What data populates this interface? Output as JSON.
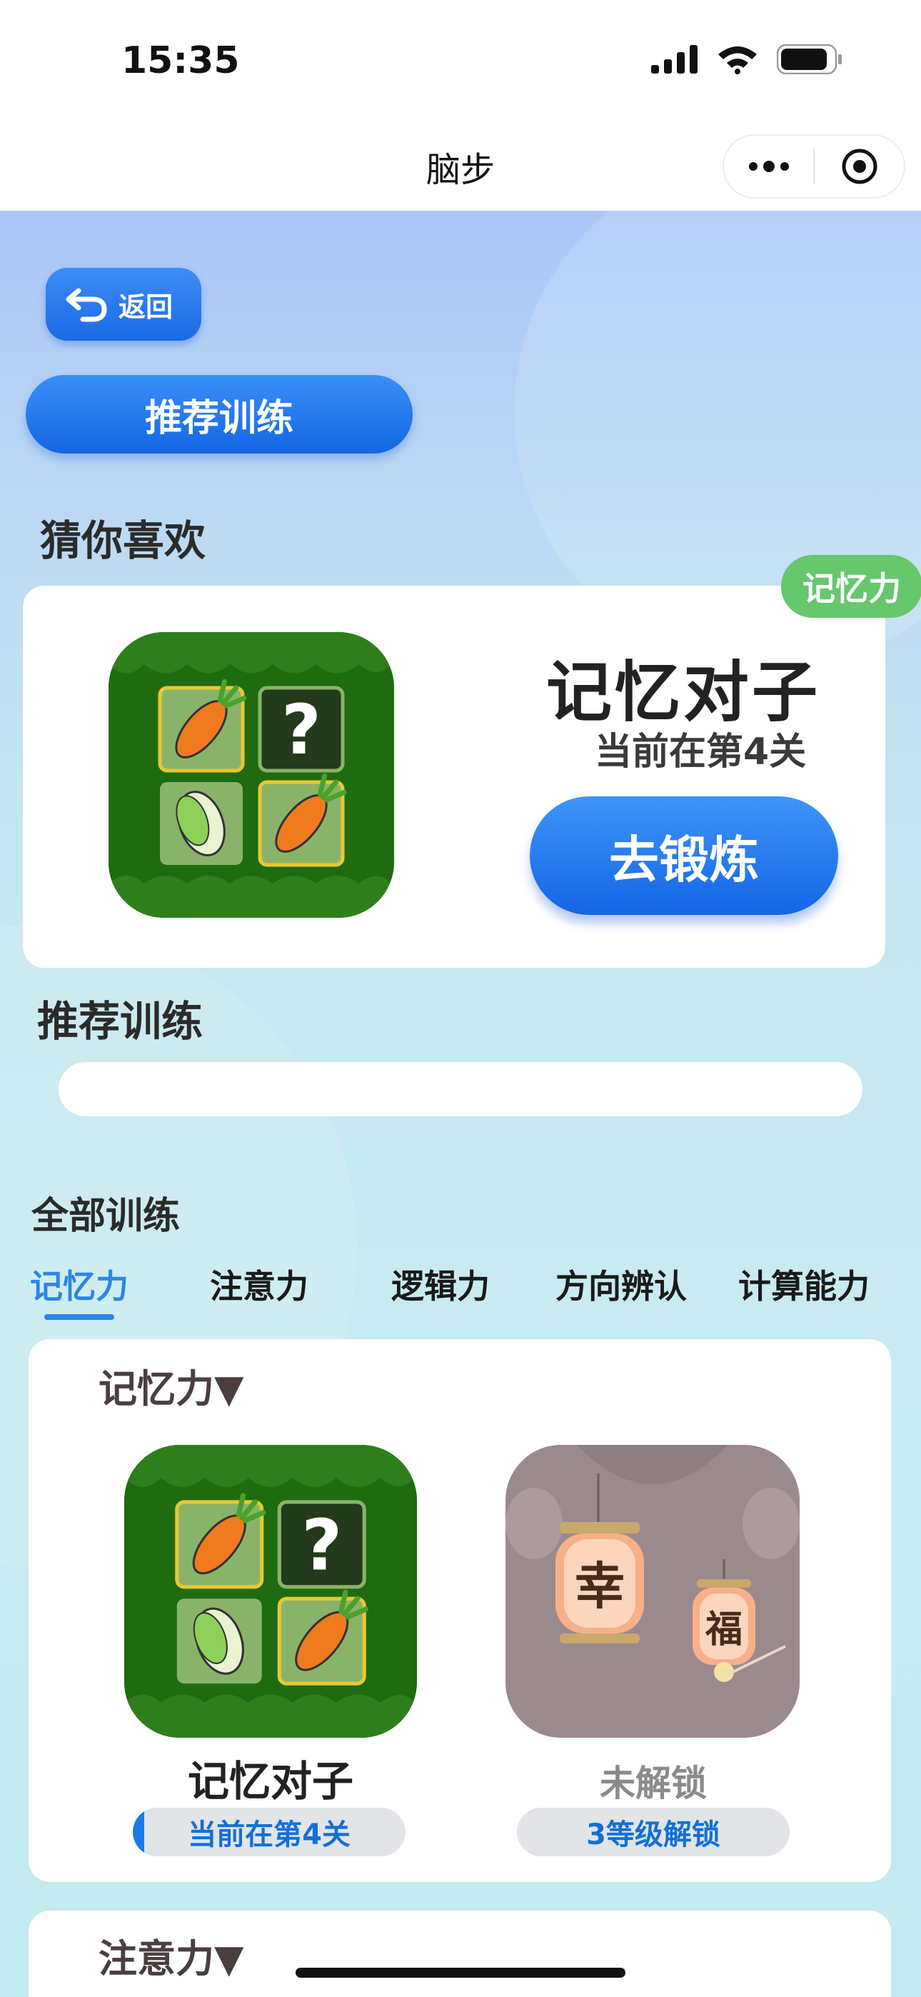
{
  "status": {
    "time": "15:35"
  },
  "nav": {
    "title": "脑步"
  },
  "back_label": "返回",
  "recommend_pill": "推荐训练",
  "favorite": {
    "section_title": "猜你喜欢",
    "tag": "记忆力",
    "game_name": "记忆对子",
    "level_text": "当前在第4关",
    "go_button": "去锻炼"
  },
  "recommend_section_title": "推荐训练",
  "all_training": {
    "section_title": "全部训练",
    "tabs": [
      "记忆力",
      "注意力",
      "逻辑力",
      "方向辨认",
      "计算能力"
    ],
    "active_tab": "记忆力"
  },
  "memory_category": {
    "title": "记忆力▼",
    "games": [
      {
        "name": "记忆对子",
        "badge": "当前在第4关",
        "icon": "memory-pairs-icon",
        "locked": false
      },
      {
        "name": "未解锁",
        "badge": "3等级解锁",
        "icon": "lantern-icon",
        "locked": true
      }
    ]
  },
  "attention_category": {
    "title": "注意力▼"
  },
  "colors": {
    "primary_blue": "#1a6ae6",
    "tag_green": "#66c76c",
    "tab_active": "#2b86e6"
  }
}
